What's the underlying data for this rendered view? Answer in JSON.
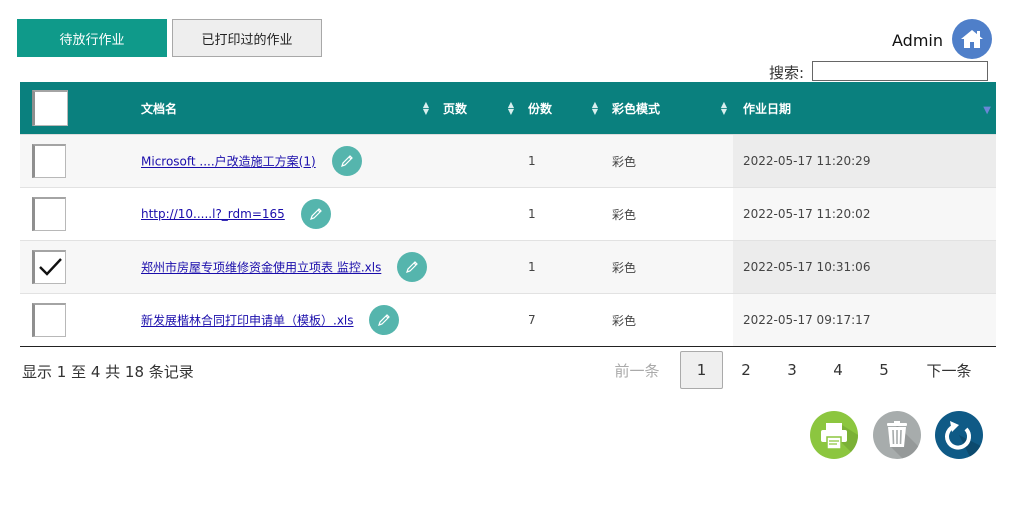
{
  "tabs": [
    {
      "label": "待放行作业",
      "active": true
    },
    {
      "label": "已打印过的作业",
      "active": false
    }
  ],
  "user": {
    "name": "Admin",
    "home_icon": "home-icon"
  },
  "search": {
    "label": "搜索:",
    "value": ""
  },
  "table": {
    "columns": [
      "文档名",
      "页数",
      "份数",
      "彩色模式",
      "作业日期"
    ],
    "rows": [
      {
        "name": "Microsoft ....户改造施工方案(1)",
        "pages": "",
        "copies": "1",
        "color_mode": "彩色",
        "date": "2022-05-17 11:20:29",
        "checked": false
      },
      {
        "name": "http://10.....l?_rdm=165",
        "pages": "",
        "copies": "1",
        "color_mode": "彩色",
        "date": "2022-05-17 11:20:02",
        "checked": false
      },
      {
        "name": "郑州市房屋专项维修资金使用立项表 监控.xls",
        "pages": "",
        "copies": "1",
        "color_mode": "彩色",
        "date": "2022-05-17 10:31:06",
        "checked": true
      },
      {
        "name": "新发展楷林合同打印申请单（模板）.xls",
        "pages": "",
        "copies": "7",
        "color_mode": "彩色",
        "date": "2022-05-17 09:17:17",
        "checked": false
      }
    ]
  },
  "pagination": {
    "info": "显示 1 至 4 共 18 条记录",
    "prev": "前一条",
    "pages": [
      "1",
      "2",
      "3",
      "4",
      "5"
    ],
    "current": "1",
    "next": "下一条"
  },
  "actions": {
    "print_icon": "print-icon",
    "delete_icon": "trash-icon",
    "refresh_icon": "refresh-icon",
    "colors": {
      "print": "#8cc63f",
      "delete": "#a7acac",
      "refresh": "#0f5a86",
      "header": "#0a807e",
      "active_tab": "#0f9a8a",
      "edit": "#55b5ad"
    }
  }
}
